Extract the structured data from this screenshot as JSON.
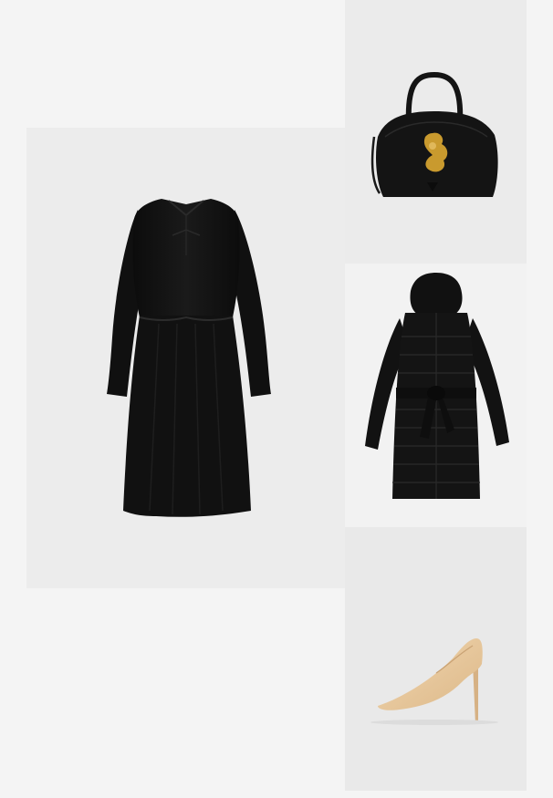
{
  "outfit": {
    "items": [
      {
        "name": "dress",
        "icon": "black-dress-image"
      },
      {
        "name": "handbag",
        "icon": "black-handbag-image"
      },
      {
        "name": "coat",
        "icon": "black-puffer-coat-image"
      },
      {
        "name": "pumps",
        "icon": "nude-pump-image"
      }
    ],
    "colors": {
      "page_background": "#f4f4f4",
      "product_black": "#111111",
      "hardware_gold": "#c99a2e",
      "pump_nude": "#e8c9a0"
    }
  }
}
